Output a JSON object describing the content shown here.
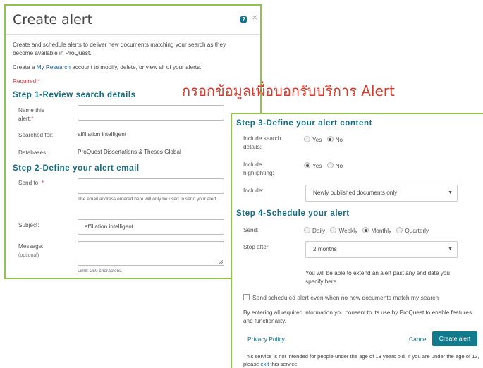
{
  "annotation": {
    "text": "กรอกข้อมูลเพื่อบอกรับบริการ Alert",
    "color": "#d83a2c"
  },
  "dialog": {
    "title": "Create alert",
    "help_icon": "question-circle-icon",
    "close_icon": "close-icon",
    "intro": "Create and schedule alerts to deliver new documents matching your search as they become available in ProQuest.",
    "create_prefix": "Create a",
    "create_link": "My Research",
    "create_suffix": "account to modify, delete, or view all of your alerts.",
    "required_note": "Required *",
    "accent_color": "#126c86",
    "border_color": "#8fc44b"
  },
  "step1": {
    "heading": "Step 1-Review search details",
    "name_label": "Name this alert:",
    "name_value": "",
    "searched_label": "Searched for:",
    "searched_value": "affiliation intelligent",
    "databases_label": "Databases:",
    "databases_value": "ProQuest Dissertations & Theses Global"
  },
  "step2": {
    "heading": "Step 2-Define your alert email",
    "sendto_label": "Send to:",
    "sendto_value": "",
    "sendto_hint": "The email address entered here will only be used to send your alert.",
    "subject_label": "Subject:",
    "subject_value": "affiliation intelligent",
    "message_label": "Message:",
    "message_optional": "(optional)",
    "message_limit": "Limit: 250 characters."
  },
  "step3": {
    "heading": "Step 3-Define your alert content",
    "search_details_label": "Include search details:",
    "search_details_options": [
      "Yes",
      "No"
    ],
    "search_details_selected": "No",
    "highlighting_label": "Include highlighting:",
    "highlighting_options": [
      "Yes",
      "No"
    ],
    "highlighting_selected": "Yes",
    "include_label": "Include:",
    "include_value": "Newly published documents only"
  },
  "step4": {
    "heading": "Step 4-Schedule your alert",
    "send_label": "Send:",
    "send_options": [
      "Daily",
      "Weekly",
      "Monthly",
      "Quarterly"
    ],
    "send_selected": "Monthly",
    "stop_label": "Stop after:",
    "stop_value": "2 months",
    "extend_note": "You will be able to extend an alert past any end date you specify here.",
    "no_new_docs_label": "Send scheduled alert even when no new documents match my search",
    "no_new_docs_checked": false
  },
  "footer": {
    "consent": "By entering all required information you consent to its use by ProQuest to enable features and functionality.",
    "privacy_link": "Privacy Policy",
    "cancel_label": "Cancel",
    "create_label": "Create alert",
    "age_notice_prefix": "This service is not intended for people under the age of 13 years old. If you are under the age of 13, please",
    "age_notice_link": "exit",
    "age_notice_suffix": "this service."
  }
}
